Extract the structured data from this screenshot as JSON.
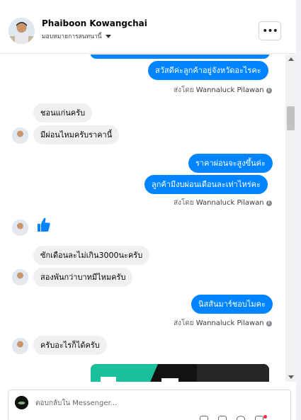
{
  "header": {
    "contact_name": "Phaiboon Kowangchai",
    "assign_label": "มอบหมายการสนทนานี้",
    "more_label": "•••"
  },
  "messages": [
    {
      "dir": "out",
      "text": ""
    },
    {
      "dir": "out",
      "text": "สวัสดีค่ะลูกค้าอยู่จังหวัดอะไรคะ"
    },
    {
      "dir": "sent_by",
      "prefix": "ส่งโดย",
      "agent": "Wannaluck Pilawan"
    },
    {
      "dir": "in",
      "text": "ชอนแก่นครับ"
    },
    {
      "dir": "in",
      "text": "มีผ่อนไหมครับราคานี้"
    },
    {
      "dir": "out",
      "text": "ราคาผ่อนจะสูงขึ้นค่ะ"
    },
    {
      "dir": "out",
      "text": "ลูกค้ามีงบผ่อนเดือนละเท่าไหร่คะ"
    },
    {
      "dir": "sent_by",
      "prefix": "ส่งโดย",
      "agent": "Wannaluck Pilawan"
    },
    {
      "dir": "in",
      "text": "ซักเดือนละไม่เกิน3000นะครับ"
    },
    {
      "dir": "in",
      "text": "สองพันกว่าบาทมีไหมครับ"
    },
    {
      "dir": "out",
      "text": "นิสสันมาร์ชอบไมคะ"
    },
    {
      "dir": "sent_by",
      "prefix": "ส่งโดย",
      "agent": "Wannaluck Pilawan"
    },
    {
      "dir": "in",
      "text": "ครับอะไรก็ได้ครับ"
    }
  ],
  "composer": {
    "placeholder": "ตอบกลับใน Messenger..."
  },
  "colors": {
    "outgoing_bubble": "#0084ff",
    "incoming_bubble": "#f0f0f0",
    "accent_dot": "#f02849"
  },
  "icons": [
    "more-icon",
    "info-icon",
    "like-thumb-icon",
    "chevron-down-icon"
  ]
}
